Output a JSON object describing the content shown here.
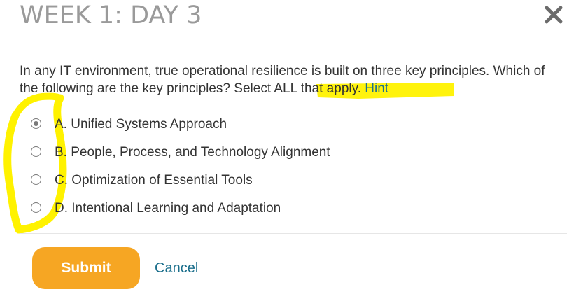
{
  "dialog": {
    "title": "WEEK 1: DAY 3",
    "close_icon": "close-icon"
  },
  "question": {
    "text_part1": "In any IT environment, true operational resilience is built on three key principles. Which of the following are the key principles? ",
    "highlight": "Select ALL that apply",
    "text_part2": ". ",
    "hint_label": "Hint"
  },
  "options": [
    {
      "label": "A. Unified Systems Approach",
      "selected": true
    },
    {
      "label": "B. People, Process, and Technology Alignment",
      "selected": false
    },
    {
      "label": "C. Optimization of Essential Tools",
      "selected": false
    },
    {
      "label": "D. Intentional Learning and Adaptation",
      "selected": false
    }
  ],
  "actions": {
    "submit_label": "Submit",
    "cancel_label": "Cancel"
  },
  "colors": {
    "accent": "#f6a623",
    "link": "#1b6f8c",
    "highlighter": "#fff200"
  }
}
